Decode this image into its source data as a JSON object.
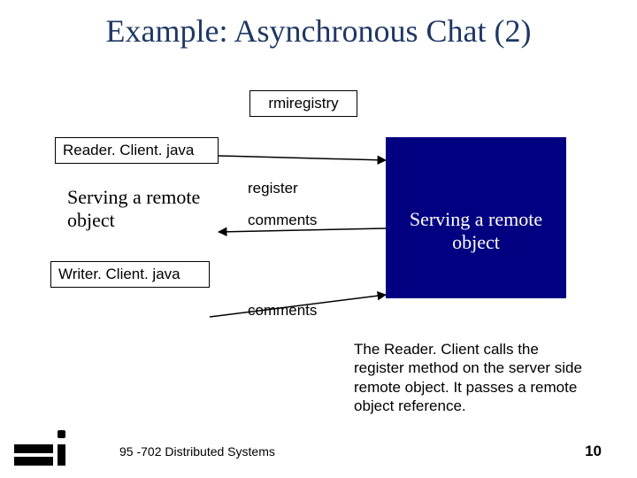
{
  "title": "Example: Asynchronous Chat (2)",
  "boxes": {
    "rmiregistry": "rmiregistry",
    "reader": "Reader. Client. java",
    "writer": "Writer. Client. java"
  },
  "serving_left": "Serving a remote object",
  "serving_right": "Serving a remote object",
  "labels": {
    "register": "register",
    "comments1": "comments",
    "comments2": "comments"
  },
  "description": "The Reader. Client calls the register method on the server side remote object. It passes a remote object reference.",
  "footer": "95 -702 Distributed Systems",
  "page_number": "10"
}
